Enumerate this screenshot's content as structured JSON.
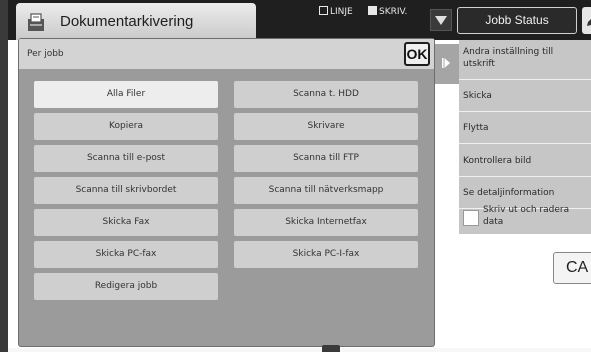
{
  "header": {
    "mode_title": "Dokumentarkivering",
    "status_line": "LINJE",
    "status_print": "SKRIV.",
    "job_status_label": "Jobb Status"
  },
  "panel": {
    "title": "Per jobb",
    "ok_label": "OK",
    "buttons_left": [
      "Alla Filer",
      "Kopiera",
      "Scanna till e-post",
      "Scanna till skrivbordet",
      "Skicka Fax",
      "Skicka PC-fax",
      "Redigera jobb"
    ],
    "buttons_right": [
      "Scanna t. HDD",
      "Skrivare",
      "Scanna till FTP",
      "Scanna till nätverksmapp",
      "Skicka Internetfax",
      "Skicka PC-I-fax"
    ],
    "selected": "Alla Filer"
  },
  "actions": {
    "item0": "Andra inställning till utskrift",
    "item1": "Skicka",
    "item2": "Flytta",
    "item3": "Kontrollera bild",
    "item4": "Se detaljinformation",
    "item5": "Skriv ut och radera data"
  },
  "ca_label": "CA",
  "icons": {
    "mode": "document-filing-icon",
    "dropdown": "triangle-down-icon",
    "toggle": "play-arrow-icon",
    "edit": "pencil-icon"
  }
}
